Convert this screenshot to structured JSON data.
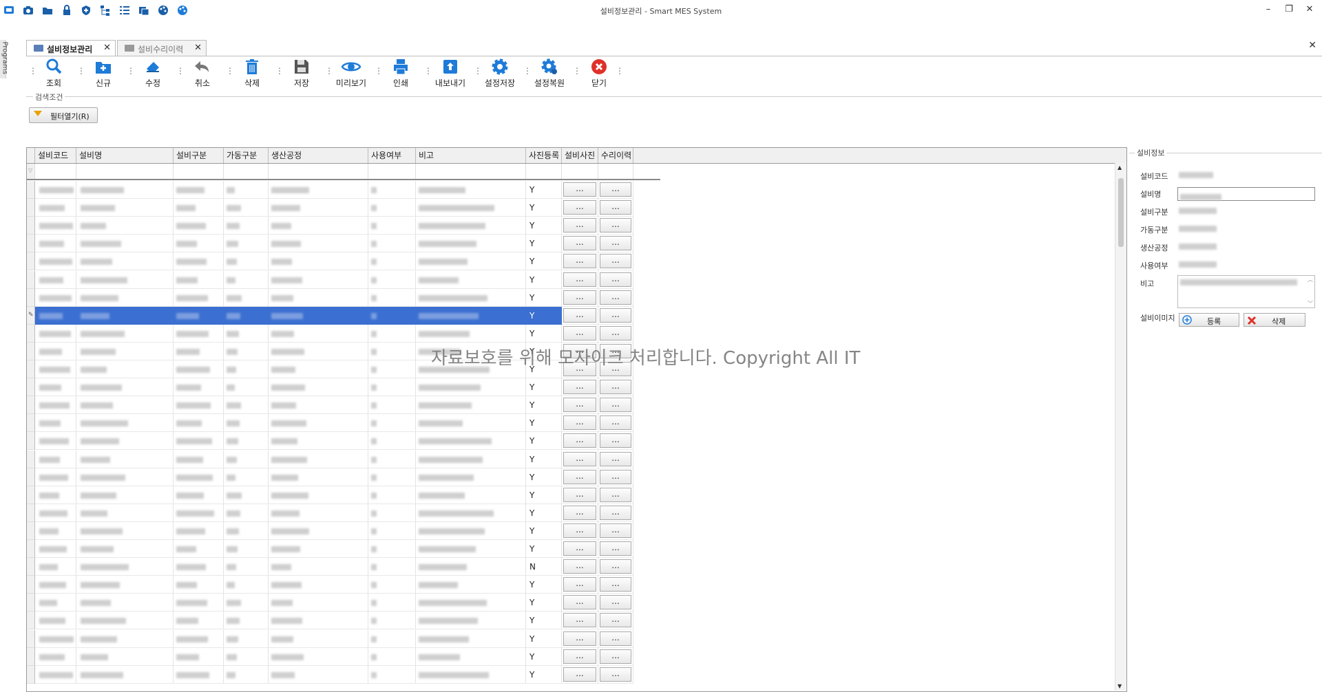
{
  "window": {
    "title": "설비정보관리 - Smart MES System"
  },
  "side": {
    "label": "Programs"
  },
  "tabs": [
    {
      "label": "설비정보관리",
      "active": true
    },
    {
      "label": "설비수리이력",
      "active": false
    }
  ],
  "toolbar": {
    "items": [
      {
        "label": "조회",
        "icon": "search-icon"
      },
      {
        "label": "신규",
        "icon": "new-folder-icon"
      },
      {
        "label": "수정",
        "icon": "eraser-icon"
      },
      {
        "label": "취소",
        "icon": "undo-icon"
      },
      {
        "label": "삭제",
        "icon": "trash-icon"
      },
      {
        "label": "저장",
        "icon": "save-icon"
      },
      {
        "label": "미리보기",
        "icon": "eye-icon"
      },
      {
        "label": "인쇄",
        "icon": "printer-icon"
      },
      {
        "label": "내보내기",
        "icon": "export-icon"
      },
      {
        "label": "설정저장",
        "icon": "gear-icon"
      },
      {
        "label": "설정복원",
        "icon": "gear-restore-icon"
      },
      {
        "label": "닫기",
        "icon": "close-circle-icon"
      }
    ]
  },
  "search": {
    "legend": "검색조건",
    "filter_button": "필터열기(R)"
  },
  "grid": {
    "columns": [
      "설비코드",
      "설비명",
      "설비구분",
      "가동구분",
      "생산공정",
      "사용여부",
      "비고",
      "사진등록",
      "설비사진",
      "수리이력"
    ],
    "button_label": "...",
    "photo_registered": [
      "Y",
      "Y",
      "Y",
      "Y",
      "Y",
      "Y",
      "Y",
      "Y",
      "Y",
      "Y",
      "Y",
      "Y",
      "Y",
      "Y",
      "Y",
      "Y",
      "Y",
      "Y",
      "Y",
      "Y",
      "Y",
      "N",
      "Y",
      "Y",
      "Y",
      "Y",
      "Y",
      "Y"
    ],
    "selected_row": 7
  },
  "watermark": "자료보호를 위해 모자이크 처리합니다. Copyright All IT",
  "detail": {
    "legend": "설비정보",
    "labels": [
      "설비코드",
      "설비명",
      "설비구분",
      "가동구분",
      "생산공정",
      "사용여부",
      "비고",
      "설비이미지"
    ],
    "register_button": "등록",
    "delete_button": "삭제"
  },
  "colors": {
    "selection": "#3b6fd1",
    "accent": "#1e7bd8",
    "close_red": "#e0302a"
  }
}
